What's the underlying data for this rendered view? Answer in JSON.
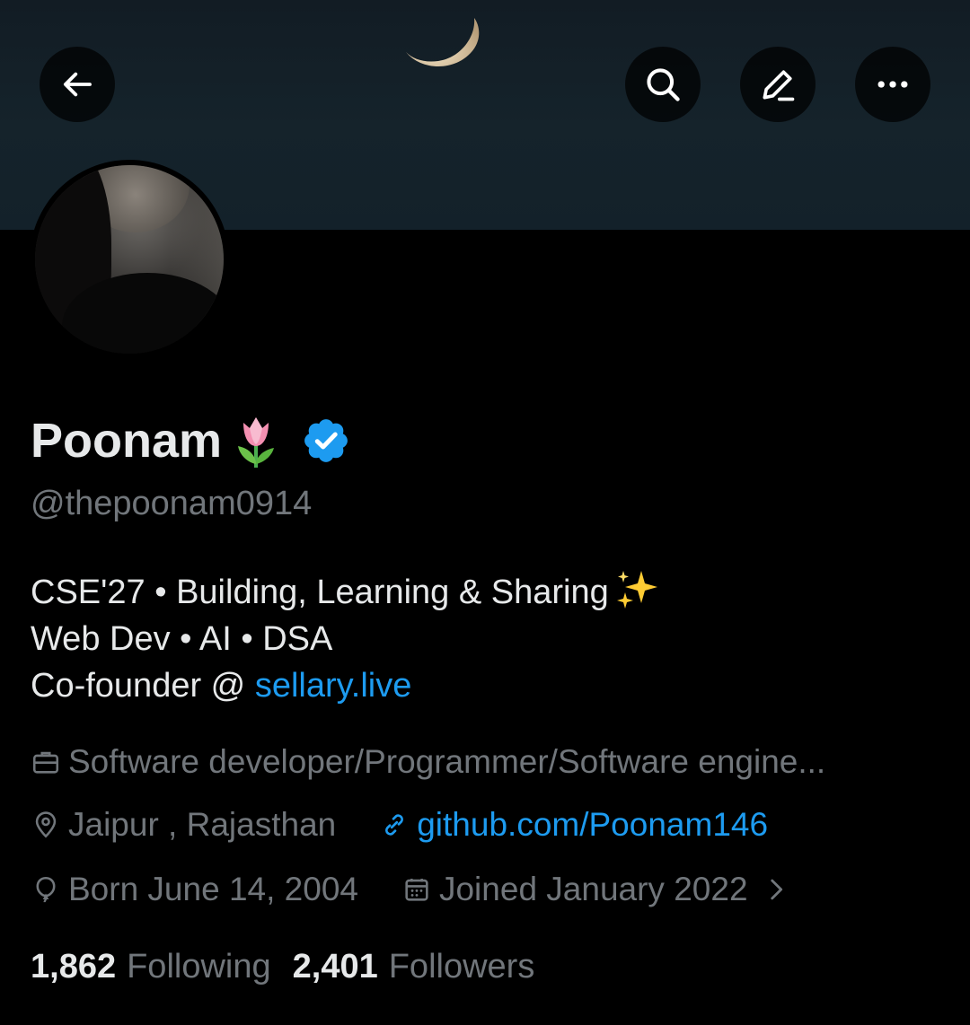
{
  "profile": {
    "display_name": "Poonam",
    "handle": "@thepoonam0914",
    "verified": true,
    "bio": {
      "line1": "CSE'27 • Building, Learning & Sharing",
      "line2": "Web Dev • AI • DSA",
      "line3_prefix": "Co-founder @ ",
      "line3_link": "sellary.live"
    },
    "category": "Software developer/Programmer/Software engine...",
    "location": "Jaipur , Rajasthan",
    "website": "github.com/Poonam146",
    "birthday": "Born June 14, 2004",
    "joined": "Joined January 2022"
  },
  "stats": {
    "following_count": "1,862",
    "following_label": "Following",
    "followers_count": "2,401",
    "followers_label": "Followers"
  },
  "icons": {
    "back": "arrow-left-icon",
    "search": "search-icon",
    "compose": "pencil-icon",
    "more": "more-horizontal-icon",
    "category": "briefcase-icon",
    "location": "location-pin-icon",
    "website": "link-icon",
    "birthday": "balloon-icon",
    "joined": "calendar-icon",
    "joined_more": "chevron-right-icon",
    "verified": "verified-badge-icon",
    "name_emoji": "tulip-emoji",
    "bio_emoji": "sparkles-emoji"
  },
  "colors": {
    "background": "#000000",
    "text_primary": "#e7e9ea",
    "text_secondary": "#71767b",
    "link": "#1d9bf0",
    "verified": "#1d9bf0",
    "banner": "#14212a"
  }
}
